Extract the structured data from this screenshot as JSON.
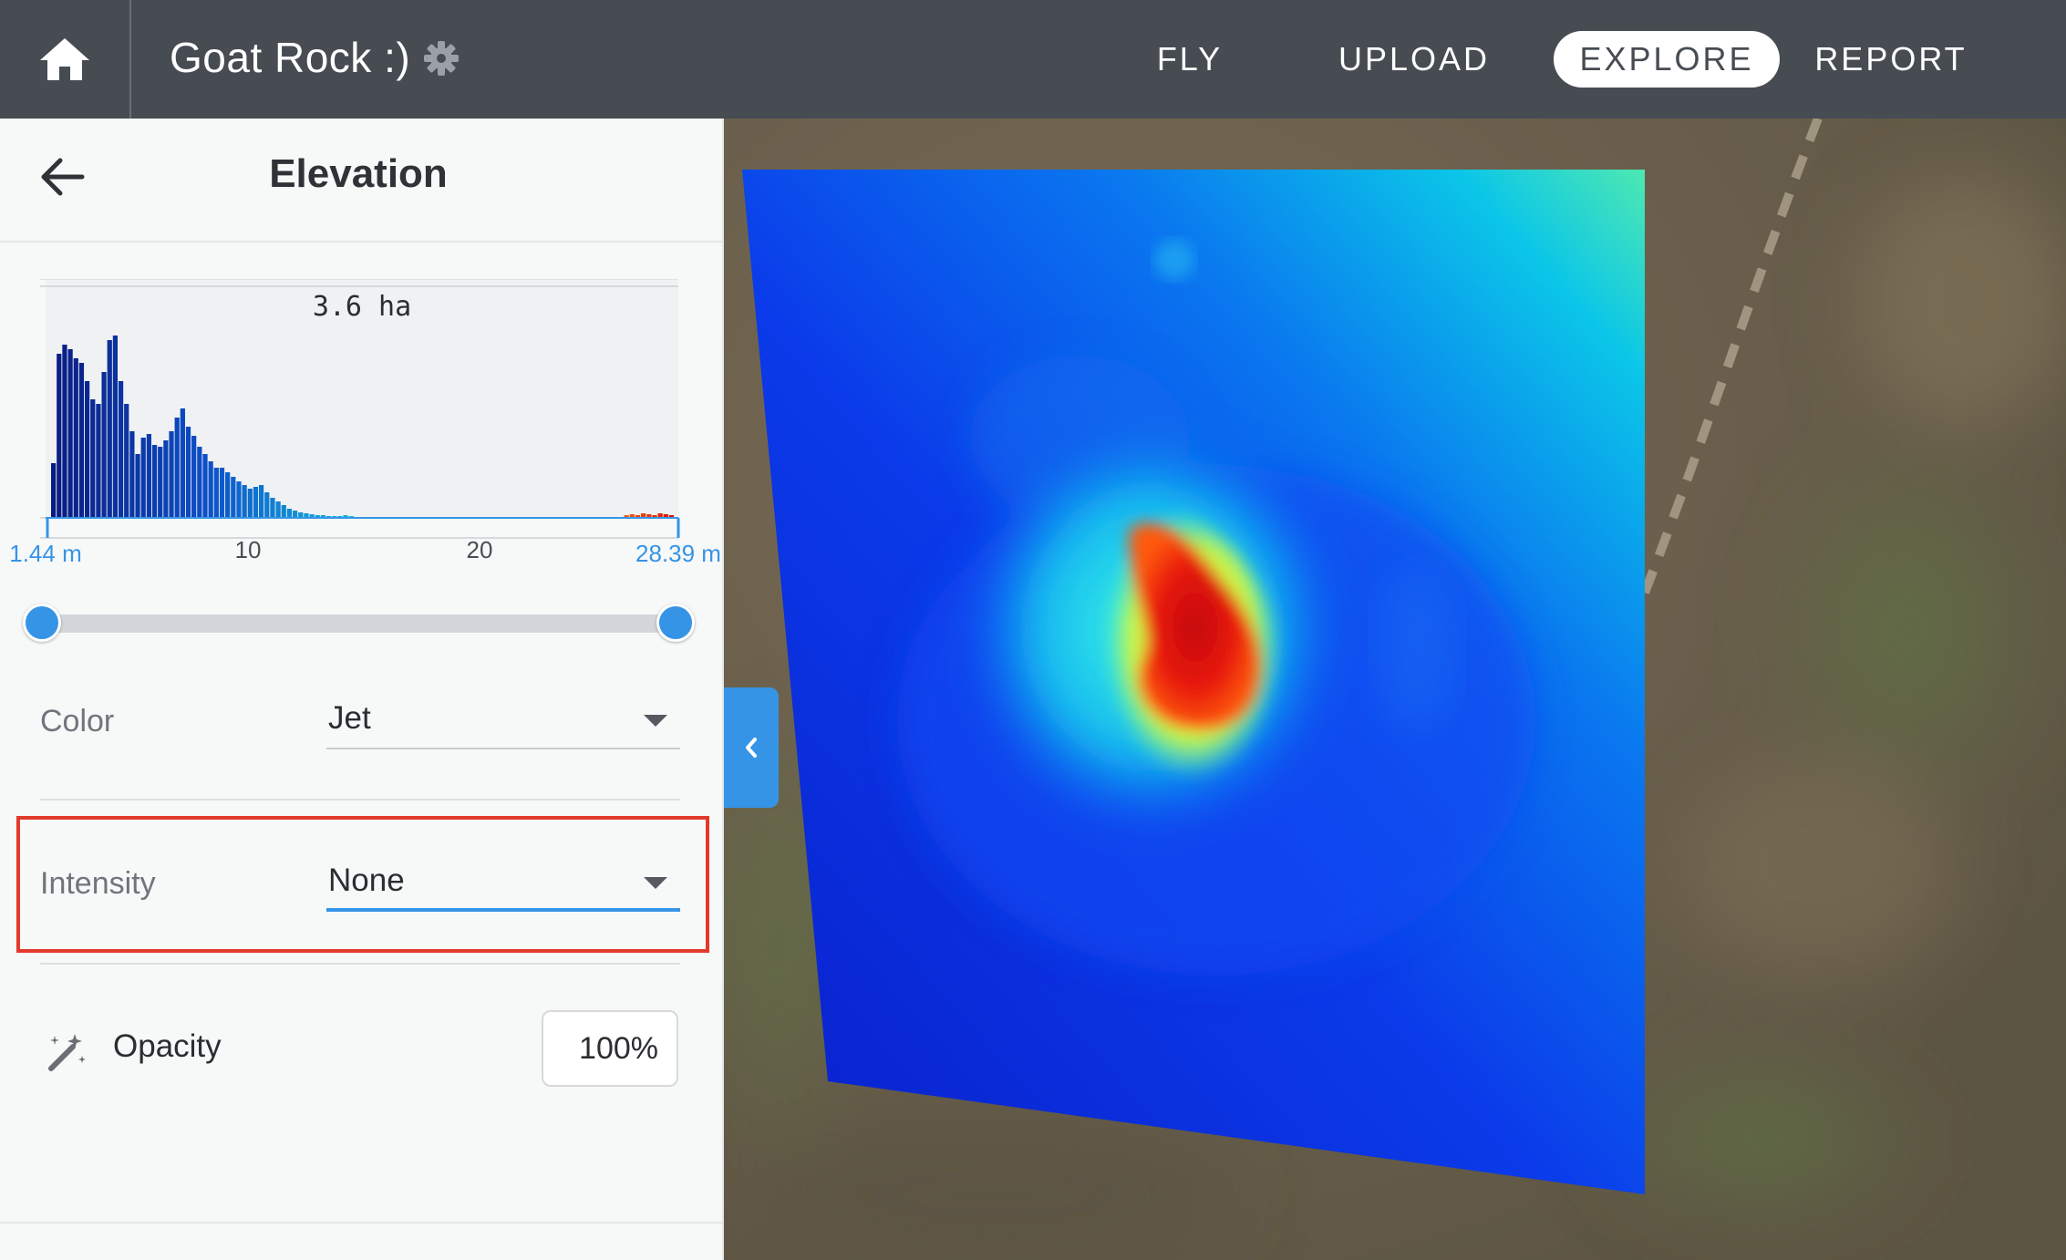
{
  "topbar": {
    "project_title": "Goat Rock :)",
    "nav": [
      {
        "label": "FLY",
        "active": false
      },
      {
        "label": "UPLOAD",
        "active": false
      },
      {
        "label": "EXPLORE",
        "active": true
      },
      {
        "label": "REPORT",
        "active": false
      }
    ]
  },
  "panel": {
    "title": "Elevation",
    "histogram": {
      "area_label": "3.6 ha",
      "min_label": "1.44 m",
      "max_label": "28.39 m",
      "tick_labels": [
        "10",
        "20"
      ]
    },
    "range_slider": {
      "min": 1.44,
      "max": 28.39,
      "low": 1.44,
      "high": 28.39
    },
    "color": {
      "label": "Color",
      "value": "Jet"
    },
    "intensity": {
      "label": "Intensity",
      "value": "None"
    },
    "opacity": {
      "label": "Opacity",
      "value": "100%"
    }
  },
  "colors": {
    "topbar": "#474c53",
    "accent": "#3694e6",
    "highlight": "#e23a2b"
  },
  "icons": {
    "home": "home-icon",
    "settings": "gear-icon",
    "back": "arrow-left-icon",
    "opacity": "magic-wand-icon",
    "collapse": "chevron-left-icon"
  }
}
